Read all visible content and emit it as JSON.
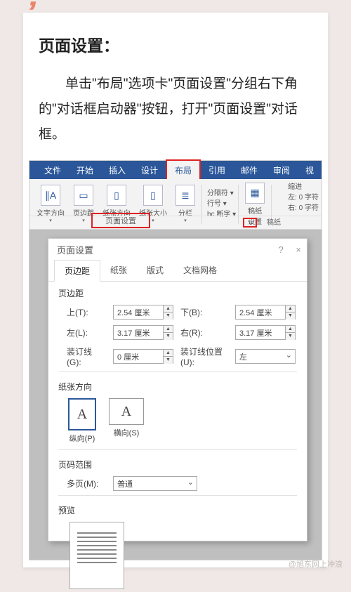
{
  "article": {
    "title": "页面设置：",
    "body": "单击\"布局\"选项卡\"页面设置\"分组右下角的\"对话框启动器\"按钮，打开\"页面设置\"对话框。"
  },
  "ribbon": {
    "tabs": [
      "文件",
      "开始",
      "插入",
      "设计",
      "布局",
      "引用",
      "邮件",
      "审阅",
      "视"
    ],
    "active_tab": "布局",
    "groups": {
      "text_direction": "文字方向",
      "margins": "页边距",
      "orientation": "纸张方向",
      "size": "纸张大小",
      "columns": "分栏",
      "breaks": "分隔符",
      "line_numbers": "行号",
      "hyphenation": "断字",
      "manuscript": "稿纸\n设置"
    },
    "indent": {
      "label": "缩进",
      "left": "左: 0 字符",
      "right": "右: 0 字符"
    },
    "page_setup_label": "页面设置",
    "paper_label": "稿纸",
    "launcher_glyph": "↘"
  },
  "dialog": {
    "title": "页面设置",
    "help": "?",
    "close": "×",
    "tabs": [
      "页边距",
      "纸张",
      "版式",
      "文档网格"
    ],
    "active_tab": "页边距",
    "margins": {
      "heading": "页边距",
      "top": {
        "label": "上(T):",
        "value": "2.54 厘米"
      },
      "bottom": {
        "label": "下(B):",
        "value": "2.54 厘米"
      },
      "left": {
        "label": "左(L):",
        "value": "3.17 厘米"
      },
      "right": {
        "label": "右(R):",
        "value": "3.17 厘米"
      },
      "gutter": {
        "label": "装订线(G):",
        "value": "0 厘米"
      },
      "gutter_pos": {
        "label": "装订线位置(U):",
        "value": "左"
      }
    },
    "orientation": {
      "heading": "纸张方向",
      "portrait": "纵向(P)",
      "landscape": "横向(S)",
      "glyph": "A"
    },
    "page_range": {
      "heading": "页码范围",
      "multi_label": "多页(M):",
      "multi_value": "普通"
    },
    "preview": {
      "heading": "预览"
    }
  },
  "watermark": "@旭东网上冲浪"
}
